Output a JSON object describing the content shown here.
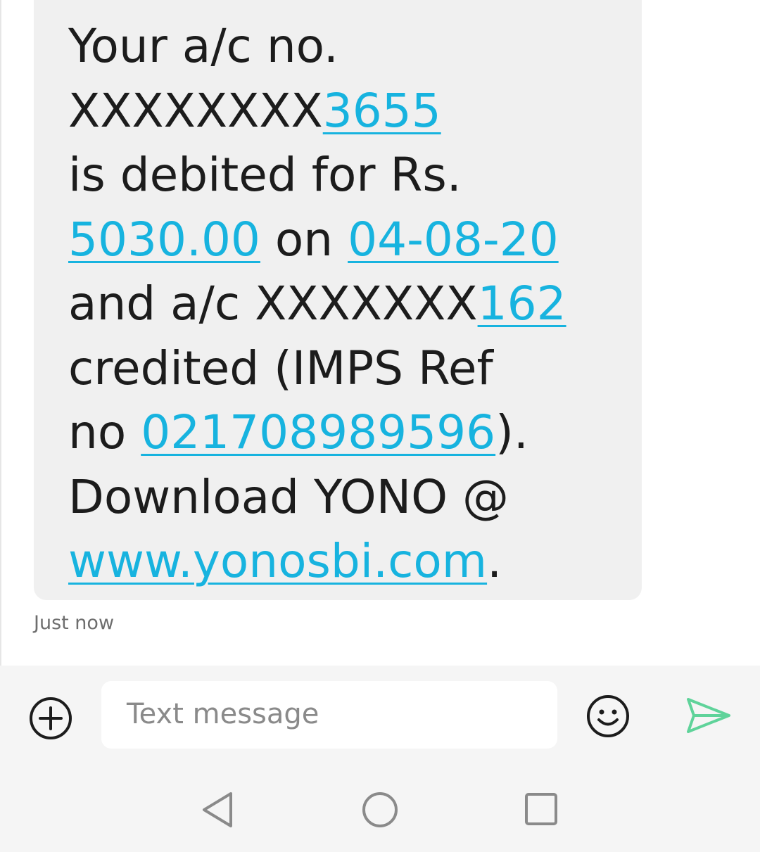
{
  "message": {
    "line1": "Your a/c no.",
    "line2_prefix": "XXXXXXXX",
    "line2_link": "3655",
    "line3": "is debited for Rs.",
    "line4_amount": "5030.00",
    "line4_on": " on ",
    "line4_date": "04-08-20",
    "line5_prefix": "and a/c XXXXXXX",
    "line5_link": "162",
    "line6": "credited (IMPS Ref",
    "line7_prefix": "no ",
    "line7_link": "021708989596",
    "line7_suffix": ").",
    "line8": "Download YONO @",
    "line9_link": "www.yonosbi.com",
    "line9_suffix": "."
  },
  "timestamp": "Just now",
  "composer": {
    "placeholder": "Text message",
    "add_icon": "plus-circle-icon",
    "emoji_icon": "smiley-icon",
    "send_icon": "send-icon"
  },
  "navbar": {
    "back_icon": "back-triangle-icon",
    "home_icon": "home-circle-icon",
    "recents_icon": "recents-square-icon"
  },
  "colors": {
    "link": "#17b3df",
    "bubble": "#f0f0f0",
    "composer_bg": "#f5f5f5",
    "send_accent": "#5fd39a"
  }
}
